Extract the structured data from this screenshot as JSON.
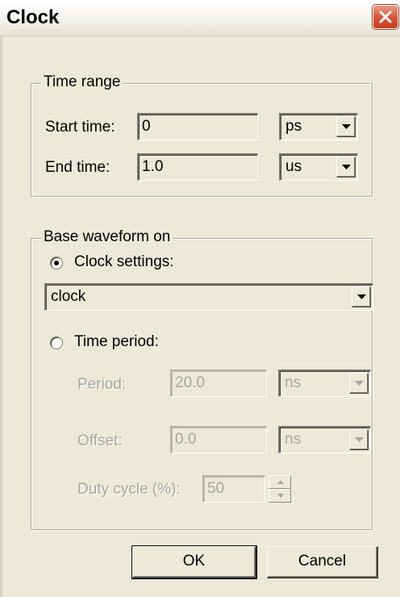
{
  "window": {
    "title": "Clock"
  },
  "time_range": {
    "title": "Time range",
    "start_label": "Start time:",
    "start_value": "0",
    "start_unit": "ps",
    "end_label": "End time:",
    "end_value": "1.0",
    "end_unit": "us"
  },
  "base_waveform": {
    "title": "Base waveform on",
    "clock_settings_label": "Clock settings:",
    "clock_settings_selected": true,
    "clock_value": "clock",
    "time_period_label": "Time period:",
    "time_period_selected": false,
    "period_label": "Period:",
    "period_value": "20.0",
    "period_unit": "ns",
    "offset_label": "Offset:",
    "offset_value": "0.0",
    "offset_unit": "ns",
    "duty_cycle_label": "Duty cycle (%):",
    "duty_cycle_value": "50"
  },
  "buttons": {
    "ok": "OK",
    "cancel": "Cancel"
  },
  "icons": {
    "close": "close-icon",
    "dropdown": "chevron-down-icon",
    "spin_up": "chevron-up-icon",
    "spin_down": "chevron-down-icon"
  },
  "colors": {
    "dialog_bg": "#ece9d8",
    "close_button": "#d9573a"
  }
}
